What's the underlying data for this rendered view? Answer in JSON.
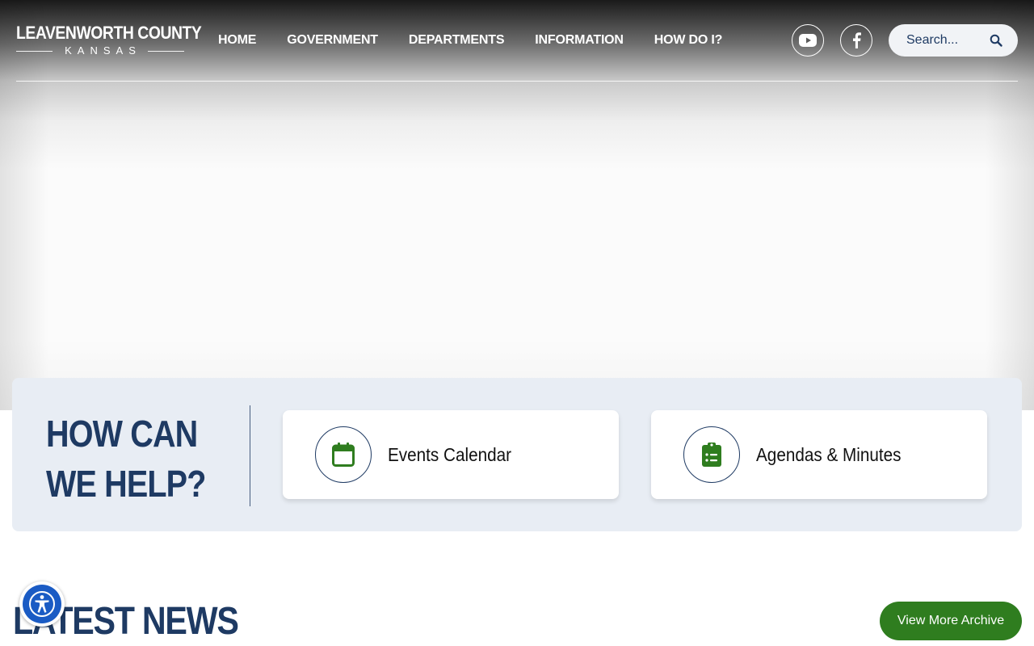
{
  "header": {
    "logo": {
      "main": "LEAVENWORTH COUNTY",
      "sub": "KANSAS"
    },
    "nav": [
      {
        "label": "HOME"
      },
      {
        "label": "GOVERNMENT"
      },
      {
        "label": "DEPARTMENTS"
      },
      {
        "label": "INFORMATION"
      },
      {
        "label": "HOW DO I?"
      }
    ],
    "social": [
      {
        "icon": "youtube-icon"
      },
      {
        "icon": "facebook-icon"
      }
    ],
    "search": {
      "placeholder": "Search...",
      "icon": "search-icon"
    }
  },
  "help": {
    "title_line1": "HOW CAN",
    "title_line2": "WE HELP?",
    "cards": [
      {
        "label": "Events Calendar",
        "icon": "calendar-icon"
      },
      {
        "label": "Agendas & Minutes",
        "icon": "clipboard-list-icon"
      }
    ]
  },
  "news": {
    "title": "LATEST NEWS",
    "archive_label": "View More Archive"
  },
  "accessibility": {
    "icon": "accessibility-icon"
  },
  "colors": {
    "navy": "#1e3a63",
    "green": "#2f7d1f",
    "panel": "#e8edf4",
    "a11y_blue": "#1a5bc4"
  }
}
